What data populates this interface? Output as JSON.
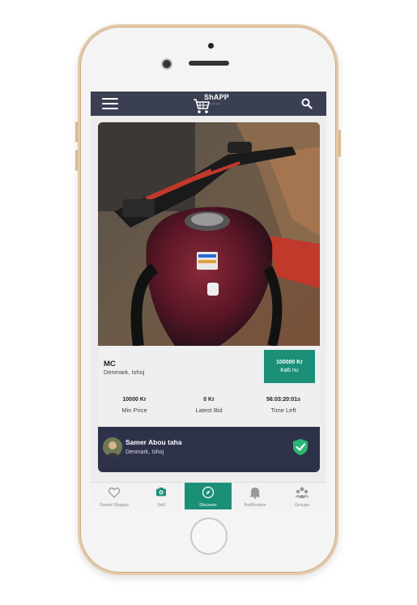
{
  "app": {
    "logo_text": "ShAPP",
    "logo_sub": "buy & sell"
  },
  "listing": {
    "title": "MC",
    "location": "Denmark, Ishoj",
    "buy_now_price": "100000 Kr",
    "buy_now_label": "Køb nu",
    "stats": [
      {
        "value": "10000 Kr",
        "label": "Min Price"
      },
      {
        "value": "0 Kr",
        "label": "Latest Bid"
      },
      {
        "value": "56:03:20:01s",
        "label": "Time Left"
      }
    ]
  },
  "seller": {
    "name": "Samer Abou taha",
    "location": "Denmark, Ishoj"
  },
  "nav": [
    {
      "label": "Saved Shapps",
      "icon": "heart-icon"
    },
    {
      "label": "Sell",
      "icon": "camera-icon"
    },
    {
      "label": "Discover",
      "icon": "compass-icon"
    },
    {
      "label": "Notification",
      "icon": "bell-icon"
    },
    {
      "label": "Groups",
      "icon": "groups-icon"
    }
  ],
  "colors": {
    "header": "#3b3f52",
    "accent": "#1b8f78",
    "seller_bar": "#2e3249"
  }
}
